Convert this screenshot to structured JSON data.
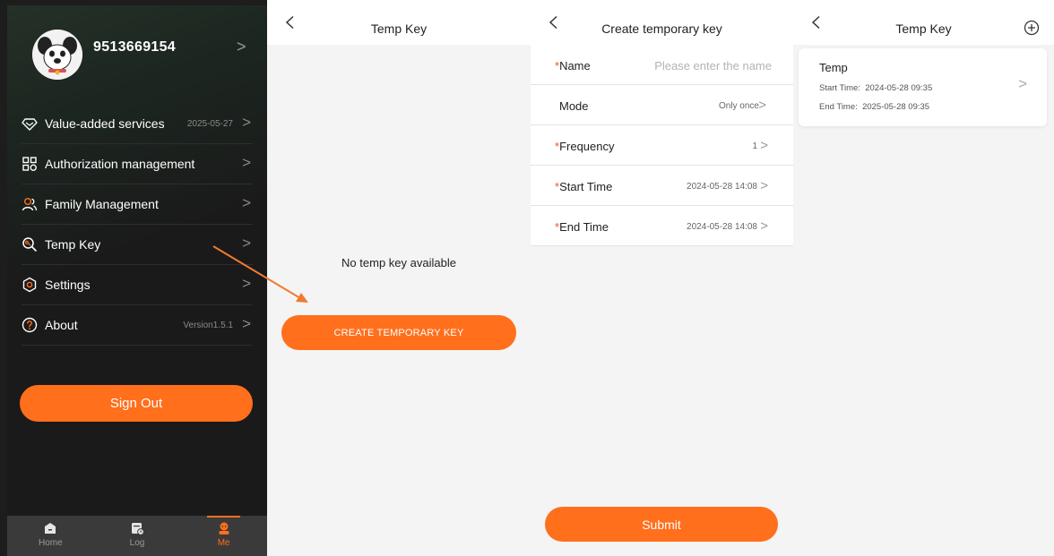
{
  "me_panel": {
    "phone": "9513669154",
    "menu": [
      {
        "label": "Value-added services",
        "meta": "2025-05-27",
        "icon": "diamond-icon"
      },
      {
        "label": "Authorization management",
        "meta": "",
        "icon": "grid-icon"
      },
      {
        "label": "Family Management",
        "meta": "",
        "icon": "users-icon"
      },
      {
        "label": "Temp Key",
        "meta": "",
        "icon": "key-search-icon"
      },
      {
        "label": "Settings",
        "meta": "",
        "icon": "gear-icon"
      },
      {
        "label": "About",
        "meta": "Version1.5.1",
        "icon": "question-icon"
      }
    ],
    "sign_out": "Sign Out",
    "tabs": [
      {
        "label": "Home",
        "icon": "home-icon"
      },
      {
        "label": "Log",
        "icon": "log-icon"
      },
      {
        "label": "Me",
        "icon": "user-icon",
        "active": true
      }
    ],
    "accent": "#ff6f1c"
  },
  "temp_key_empty": {
    "title": "Temp Key",
    "empty_text": "No temp key available",
    "create_button": "CREATE TEMPORARY KEY"
  },
  "create_key": {
    "title": "Create temporary key",
    "fields": [
      {
        "label": "Name",
        "required": "*",
        "placeholder": "Please enter the name"
      },
      {
        "label": "Mode",
        "required": "",
        "value": "Only once"
      },
      {
        "label": "Frequency",
        "required": "*",
        "value": "1"
      },
      {
        "label": "Start Time",
        "required": "*",
        "value": "2024-05-28  14:08"
      },
      {
        "label": "End Time",
        "required": "*",
        "value": "2024-05-28  14:08"
      }
    ],
    "submit": "Submit"
  },
  "temp_key_list": {
    "title": "Temp Key",
    "items": [
      {
        "name": "Temp",
        "start_label": "Start Time:",
        "start": "2024-05-28  09:35",
        "end_label": "End Time:",
        "end": "2025-05-28  09:35"
      }
    ]
  }
}
